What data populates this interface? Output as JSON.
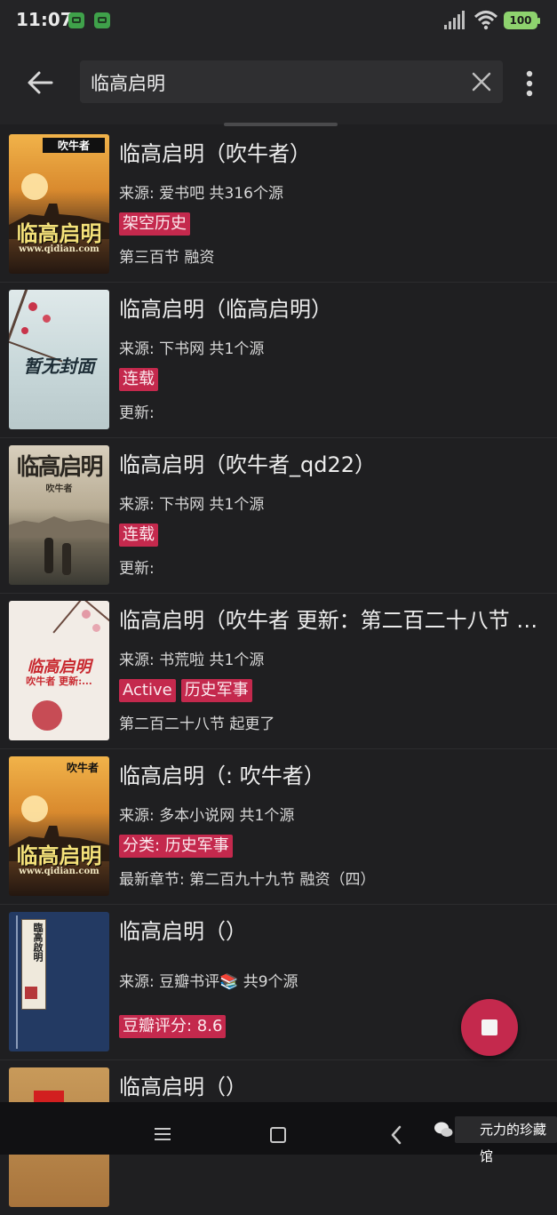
{
  "status_bar": {
    "time": "11:07",
    "battery": "100"
  },
  "toolbar": {
    "query": "临高启明"
  },
  "colors": {
    "accent": "#c4294d",
    "background": "#1f1f21"
  },
  "results": [
    {
      "title": "临高启明（吹牛者）",
      "source": "来源: 爱书吧  共316个源",
      "tags": [
        "架空历史"
      ],
      "latest": "第三百节 融资",
      "cover": {
        "top": "吹牛者",
        "main": "临高启明",
        "sub": "www.qidian.com"
      }
    },
    {
      "title": "临高启明（临高启明）",
      "source": "来源: 下书网  共1个源",
      "tags": [
        "连载"
      ],
      "latest": "更新:",
      "cover": {
        "main": "暂无封面"
      }
    },
    {
      "title": "临高启明（吹牛者_qd22）",
      "source": "来源: 下书网  共1个源",
      "tags": [
        "连载"
      ],
      "latest": "更新:",
      "cover": {
        "main": "临高启明",
        "sub": "吹牛者"
      }
    },
    {
      "title": "临高启明（吹牛者 更新：第二百二十八节 起更了）",
      "source": "来源: 书荒啦  共1个源",
      "tags": [
        "Active",
        "历史军事"
      ],
      "latest": "第二百二十八节 起更了",
      "cover": {
        "main": "临高启明",
        "sub": "吹牛者 更新:..."
      }
    },
    {
      "title": "临高启明（: 吹牛者）",
      "source": "来源: 多本小说网  共1个源",
      "tags": [
        "分类: 历史军事"
      ],
      "latest": "最新章节: 第二百九十九节 融资（四）",
      "cover": {
        "top": "吹牛者",
        "main": "临高启明",
        "sub": "www.qidian.com"
      }
    },
    {
      "title": "临高启明（）",
      "source": "来源: 豆瓣书评📚  共9个源",
      "tags": [
        "豆瓣评分: 8.6"
      ],
      "latest": "",
      "cover": {
        "main": "臨高啟明"
      }
    },
    {
      "title": "临高启明（）"
    }
  ],
  "watermark": "元力的珍藏馆"
}
